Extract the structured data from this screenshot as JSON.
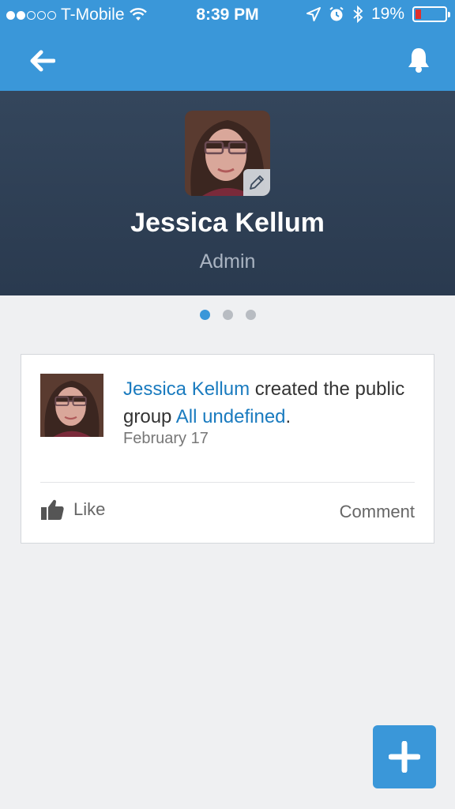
{
  "status_bar": {
    "carrier": "T-Mobile",
    "time": "8:39 PM",
    "battery": "19%",
    "battery_level": 0.19,
    "signal_bars_filled": 2,
    "signal_bars_total": 5
  },
  "nav": {
    "back_icon": "arrow-left-icon",
    "bell_icon": "bell-icon"
  },
  "profile": {
    "name": "Jessica Kellum",
    "role": "Admin",
    "edit_icon": "pencil-icon"
  },
  "pager": {
    "pages": 3,
    "active_page": 1
  },
  "feed": [
    {
      "actor": "Jessica Kellum",
      "action": " created the public group ",
      "target": "All undefined",
      "end": ".",
      "date": "February 17",
      "like_label": "Like",
      "comment_label": "Comment"
    }
  ],
  "fab": {
    "icon": "plus-icon"
  },
  "colors": {
    "accent": "#3a97d9",
    "hero_bg": "#2f4055",
    "link": "#1a7bbf",
    "page_bg": "#eff0f2"
  }
}
